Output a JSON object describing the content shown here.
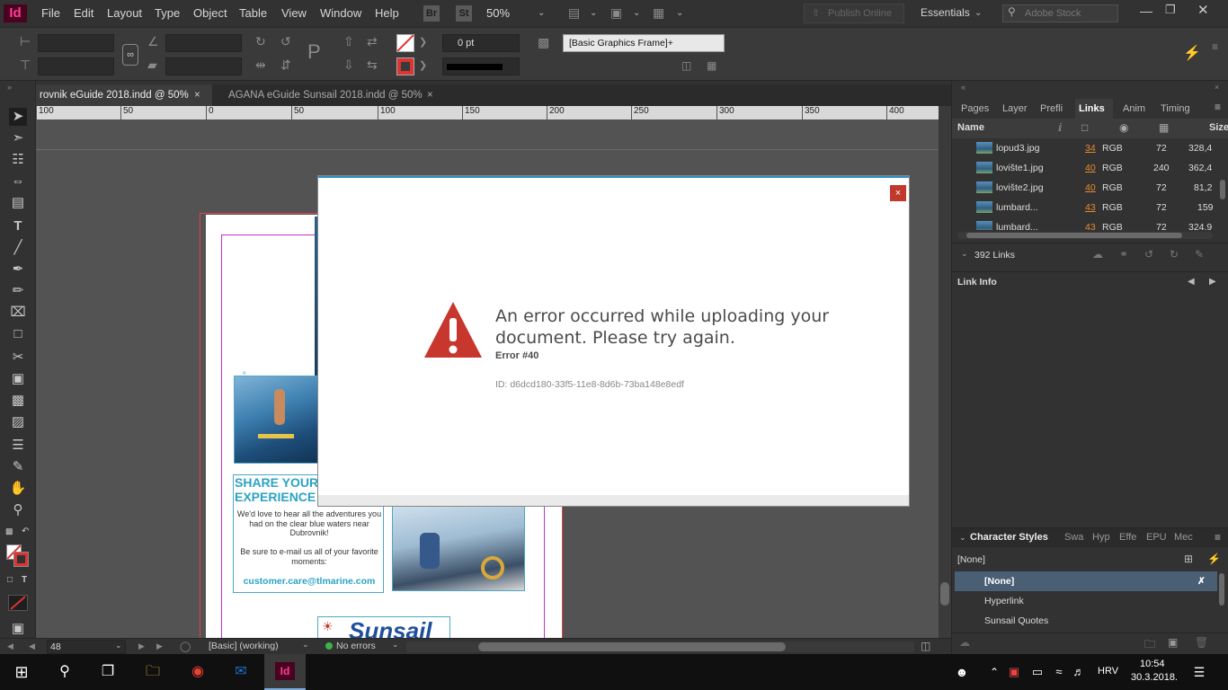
{
  "app": {
    "icon_label": "Id",
    "menu": [
      "File",
      "Edit",
      "Layout",
      "Type",
      "Object",
      "Table",
      "View",
      "Window",
      "Help"
    ],
    "bridge_label": "Br",
    "stock_label": "St",
    "zoom": "50%",
    "publish_online": "Publish Online",
    "workspace": "Essentials",
    "search_placeholder": "Adobe Stock"
  },
  "control": {
    "stroke_weight": "0 pt",
    "frame_style": "[Basic Graphics Frame]+"
  },
  "tabs": [
    {
      "label": "rovnik eGuide 2018.indd @ 50%",
      "active": true
    },
    {
      "label": "AGANA eGuide Sunsail 2018.indd @ 50%",
      "active": false
    }
  ],
  "ruler_ticks": [
    "100",
    "50",
    "0",
    "50",
    "100",
    "150",
    "200",
    "250",
    "300",
    "350",
    "400"
  ],
  "page": {
    "headline": "SHARE YOUR EXPERIENCE W",
    "headline_line1": "SHARE YOUR",
    "headline_line2": "EXPERIENCE W",
    "body1": "We'd love to hear all the adventures you had on the clear blue waters near Dubrovnik!",
    "body2": "Be sure to e-mail us all of your favorite moments:",
    "email": "customer.care@tlmarine.com",
    "logo": "Sunsail"
  },
  "modal": {
    "close_label": "×",
    "message_line1": "An error occurred while uploading your",
    "message_line2": "document. Please try again.",
    "error_code": "Error #40",
    "error_id": "ID: d6dcd180-33f5-11e8-8d6b-73ba148e8edf"
  },
  "panels": {
    "tabs": [
      "Pages",
      "Layers",
      "Preflight",
      "Links",
      "Animation",
      "Timing"
    ],
    "tab_labels": [
      "Pages",
      "Layer",
      "Prefli",
      "Links",
      "Anim",
      "Timing"
    ],
    "links_header_name": "Name",
    "links_header_size": "Size",
    "links": [
      {
        "name": "lopud3.jpg",
        "page": "34",
        "color": "RGB",
        "ppi": "72",
        "size": "328,4"
      },
      {
        "name": "lovište1.jpg",
        "page": "40",
        "color": "RGB",
        "ppi": "240",
        "size": "362,4"
      },
      {
        "name": "lovište2.jpg",
        "page": "40",
        "color": "RGB",
        "ppi": "72",
        "size": "81,2"
      },
      {
        "name": "lumbard...",
        "page": "43",
        "color": "RGB",
        "ppi": "72",
        "size": "159"
      },
      {
        "name": "lumbard...",
        "page": "43",
        "color": "RGB",
        "ppi": "72",
        "size": "324,9"
      }
    ],
    "links_count": "392 Links",
    "link_info": "Link Info",
    "char_styles_title": "Character Styles",
    "char_styles_tabs": [
      "Swa",
      "Hyp",
      "Effe",
      "EPU",
      "Mec"
    ],
    "char_current": "[None]",
    "char_styles": [
      "[None]",
      "Hyperlink",
      "Sunsail Quotes"
    ]
  },
  "status": {
    "page_number": "48",
    "preflight_profile": "[Basic] (working)",
    "errors": "No errors"
  },
  "taskbar": {
    "language": "HRV",
    "time": "10:54",
    "date": "30.3.2018."
  },
  "colors": {
    "accent": "#2d8ec4",
    "error_red": "#c0392b",
    "heading_blue": "#2ba3c4",
    "link_orange": "#e68a2e"
  }
}
